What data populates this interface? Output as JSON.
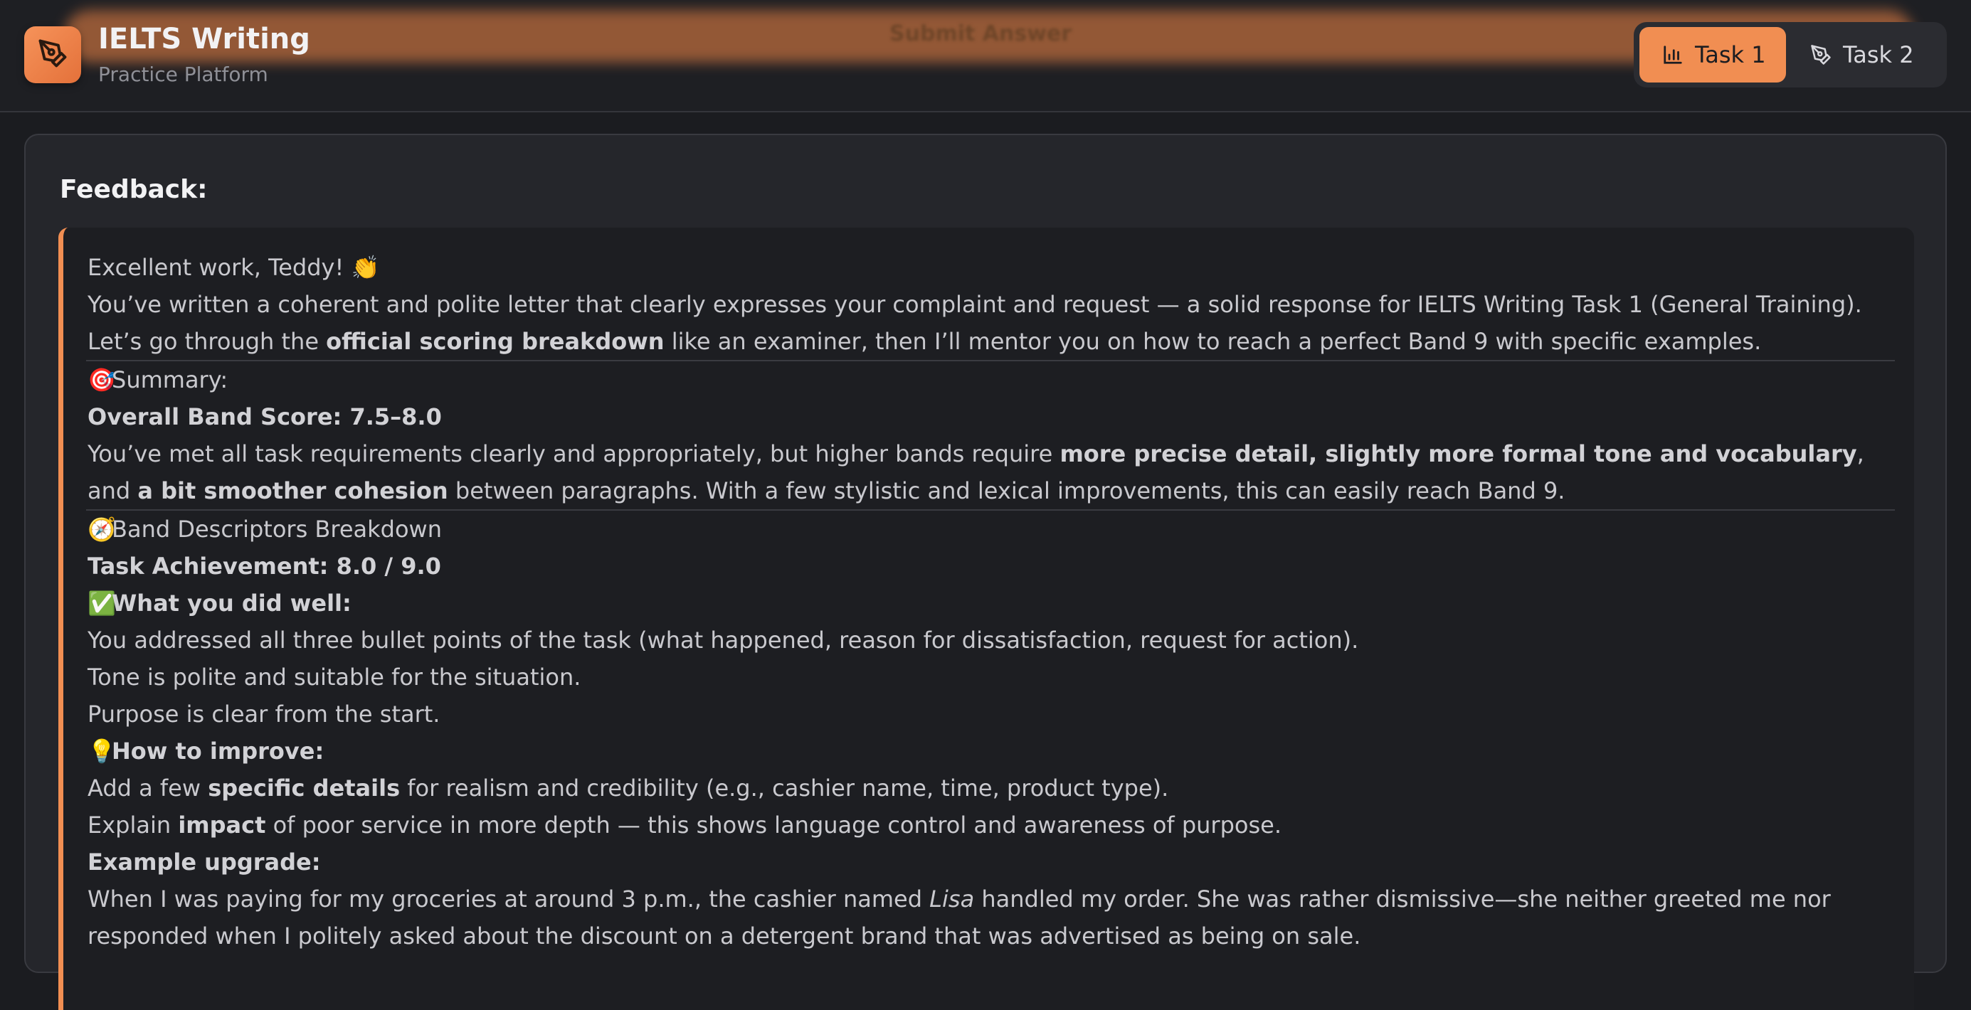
{
  "header": {
    "app_title": "IELTS Writing",
    "app_subtitle": "Practice Platform",
    "submit_label": "Submit Answer",
    "logo_icon": "pen-tool-icon",
    "tabs": [
      {
        "label": "Task 1",
        "icon": "bar-chart-icon",
        "active": true
      },
      {
        "label": "Task 2",
        "icon": "pen-tool-icon",
        "active": false
      }
    ]
  },
  "colors": {
    "accent": "#f18e52",
    "background": "#1b1c20",
    "card": "#25262b",
    "feedback_box": "#1d1e22"
  },
  "feedback": {
    "title": "Feedback:",
    "intro": {
      "greeting": "Excellent work, Teddy! 👏",
      "line2": "You’ve written a coherent and polite letter that clearly expresses your complaint and request — a solid response for IELTS Writing Task 1 (General Training).",
      "line3_pre": "Let’s go through the ",
      "line3_bold": "official scoring breakdown",
      "line3_post": " like an examiner, then I’ll mentor you on how to reach a perfect Band 9 with specific examples."
    },
    "summary": {
      "emoji": "🎯",
      "heading": "Summary:",
      "score": "Overall Band Score: 7.5–8.0",
      "p_pre": "You’ve met all task requirements clearly and appropriately, but higher bands require ",
      "p_bold1": "more precise detail, slightly more formal tone and vocabulary",
      "p_mid": ", and ",
      "p_bold2": "a bit smoother cohesion",
      "p_post": " between paragraphs. With a few stylistic and lexical improvements, this can easily reach Band 9."
    },
    "breakdown": {
      "emoji": "🧭",
      "heading": "Band Descriptors Breakdown",
      "task_achievement": "Task Achievement: 8.0 / 9.0",
      "well_emoji": "✅",
      "well_heading": "What you did well:",
      "well_points": [
        "You addressed all three bullet points of the task (what happened, reason for dissatisfaction, request for action).",
        "Tone is polite and suitable for the situation.",
        "Purpose is clear from the start."
      ],
      "improve_emoji": "💡",
      "improve_heading": "How to improve:",
      "improve_1_pre": "Add a few ",
      "improve_1_bold": "specific details",
      "improve_1_post": " for realism and credibility (e.g., cashier name, time, product type).",
      "improve_2_pre": "Explain ",
      "improve_2_bold": "impact",
      "improve_2_post": " of poor service in more depth — this shows language control and awareness of purpose.",
      "example_heading": "Example upgrade:",
      "example_pre": "When I was paying for my groceries at around 3 p.m., the cashier named ",
      "example_italic": "Lisa",
      "example_post": " handled my order. She was rather dismissive—she neither greeted me nor responded when I politely asked about the discount on a detergent brand that was advertised as being on sale."
    }
  }
}
